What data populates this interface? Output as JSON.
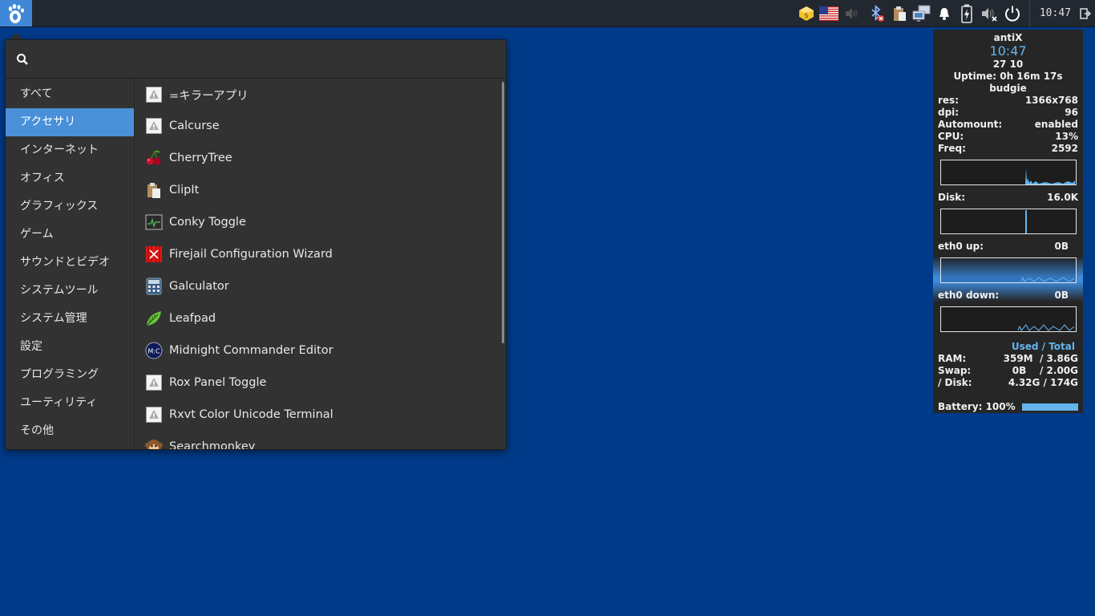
{
  "panel": {
    "clock": "10:47",
    "tray_icons": [
      "package-updates-icon",
      "us-flag-icon",
      "volume-muted-icon",
      "bluetooth-off-icon",
      "clipboard-icon",
      "network-icon",
      "notification-bell-icon",
      "battery-charging-icon",
      "volume-muted-icon",
      "power-icon",
      "logout-icon"
    ]
  },
  "menu": {
    "search": {
      "value": "",
      "placeholder": ""
    },
    "categories": [
      "すべて",
      "アクセサリ",
      "インターネット",
      "オフィス",
      "グラフィックス",
      "ゲーム",
      "サウンドとビデオ",
      "システムツール",
      "システム管理",
      "設定",
      "プログラミング",
      "ユーティリティ",
      "その他"
    ],
    "active_category": "アクセサリ",
    "apps": [
      {
        "label": "=キラーアプリ",
        "icon": "generic-app-icon"
      },
      {
        "label": "Calcurse",
        "icon": "generic-app-icon"
      },
      {
        "label": "CherryTree",
        "icon": "cherry-icon"
      },
      {
        "label": "ClipIt",
        "icon": "clipboard-icon"
      },
      {
        "label": "Conky Toggle",
        "icon": "monitor-graph-icon"
      },
      {
        "label": "Firejail Configuration Wizard",
        "icon": "firejail-icon"
      },
      {
        "label": "Galculator",
        "icon": "calculator-icon"
      },
      {
        "label": "Leafpad",
        "icon": "leaf-icon"
      },
      {
        "label": "Midnight Commander Editor",
        "icon": "mc-icon"
      },
      {
        "label": "Rox Panel Toggle",
        "icon": "generic-app-icon"
      },
      {
        "label": "Rxvt Color Unicode Terminal",
        "icon": "generic-app-icon"
      },
      {
        "label": "Searchmonkey",
        "icon": "monkey-icon"
      }
    ]
  },
  "conky": {
    "hostname": "antiX",
    "time": "10:47",
    "date": " 27 10",
    "uptime": "Uptime: 0h 16m 17s",
    "desktop": "budgie",
    "res_label": "res:",
    "res": "1366x768",
    "dpi_label": "dpi:",
    "dpi": "96",
    "automount_label": "Automount:",
    "automount": "enabled",
    "cpu_label": "CPU:",
    "cpu": "13%",
    "freq_label": "Freq:",
    "freq": "2592",
    "disk_label": "Disk:",
    "disk": "16.0K",
    "eth0_up_label": "eth0 up:",
    "eth0_up": "0B",
    "eth0_down_label": "eth0 down:",
    "eth0_down": "0B",
    "used_total": "Used / Total",
    "ram_label": "RAM:",
    "ram": "359M  / 3.86G",
    "swap_label": "Swap:",
    "swap": "0B    / 2.00G",
    "disk_usage_label": "/ Disk:",
    "disk_usage": "4.32G / 174G",
    "battery_label": "Battery: 100%",
    "battery_level": 1.0,
    "accent": "#64b5ee"
  }
}
